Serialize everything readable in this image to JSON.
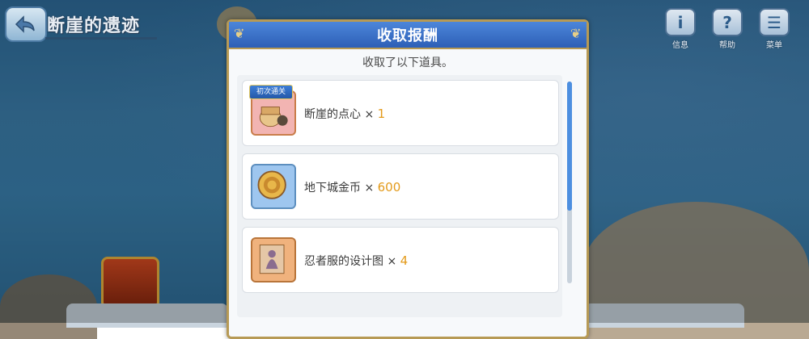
{
  "stage": {
    "title": "断崖的遗迹"
  },
  "top_buttons": [
    {
      "name": "info",
      "glyph": "i",
      "label": "信息"
    },
    {
      "name": "help",
      "glyph": "?",
      "label": "帮助"
    },
    {
      "name": "menu",
      "glyph": "☰",
      "label": "菜单"
    }
  ],
  "dialog": {
    "title": "收取报酬",
    "subtitle": "收取了以下道具。",
    "items": [
      {
        "name": "断崖的点心",
        "qty_prefix": " × ",
        "qty": "1",
        "badge": "初次通关",
        "icon": "snack-icon",
        "frame_color": "#f2b4b2"
      },
      {
        "name": "地下城金币",
        "qty_prefix": " × ",
        "qty": "600",
        "icon": "gold-coin-icon",
        "frame_color": "#9ec6ef"
      },
      {
        "name": "忍者服的设计图",
        "qty_prefix": " × ",
        "qty": "4",
        "icon": "blueprint-icon",
        "frame_color": "#f0b27d"
      }
    ]
  }
}
